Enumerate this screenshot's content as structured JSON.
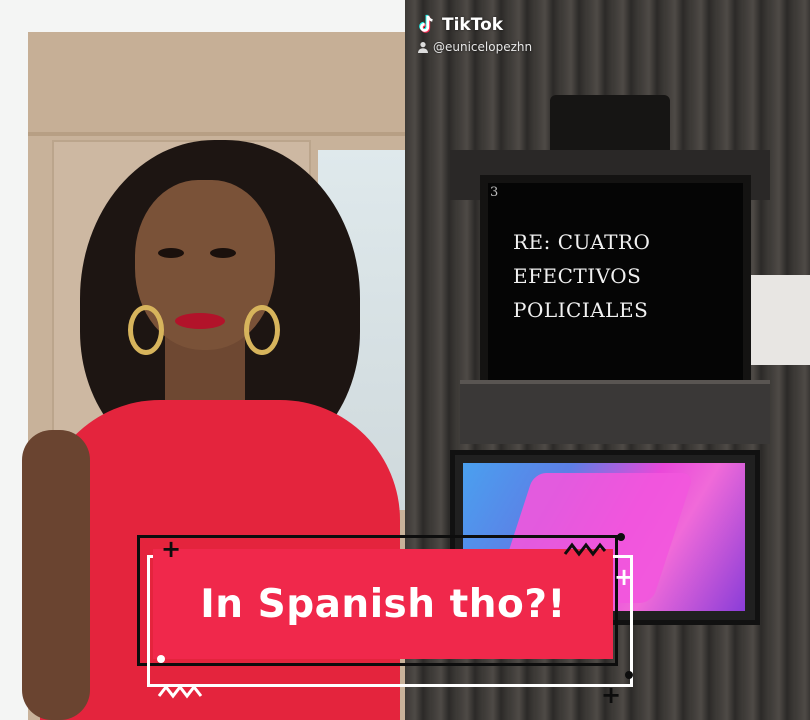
{
  "watermark": {
    "app_name": "TikTok",
    "handle": "@eunicelopezhn"
  },
  "teleprompter": {
    "line_number": "3",
    "lines": [
      "RE: CUATRO",
      "EFECTIVOS",
      "POLICIALES"
    ]
  },
  "caption": {
    "text": "In Spanish tho?!"
  },
  "colors": {
    "caption_bg": "#f0284b",
    "dress": "#e4243d",
    "frame_dark": "#0d0d0d",
    "frame_light": "#ffffff"
  }
}
